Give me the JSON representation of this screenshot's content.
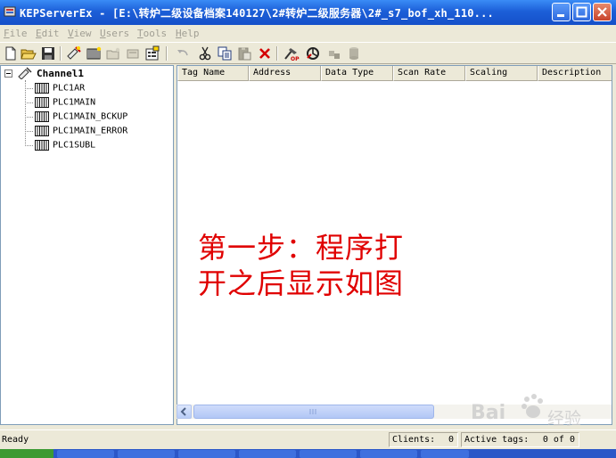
{
  "window": {
    "title": "KEPServerEx - [E:\\转炉二级设备档案140127\\2#转炉二级服务器\\2#_s7_bof_xh_110..."
  },
  "menu": {
    "items": [
      {
        "first": "F",
        "rest": "ile"
      },
      {
        "first": "E",
        "rest": "dit"
      },
      {
        "first": "V",
        "rest": "iew"
      },
      {
        "first": "U",
        "rest": "sers"
      },
      {
        "first": "T",
        "rest": "ools"
      },
      {
        "first": "H",
        "rest": "elp"
      }
    ]
  },
  "toolbar": {
    "icons": [
      "new-file-icon",
      "open-folder-icon",
      "save-icon",
      "new-channel-icon",
      "new-device-icon",
      "new-group-icon",
      "new-tag-icon",
      "properties-icon",
      "undo-icon",
      "cut-icon",
      "copy-icon",
      "paste-icon",
      "delete-icon",
      "quick-client-icon",
      "runtime-connect-icon",
      "runtime-icon",
      "database-icon"
    ]
  },
  "tree": {
    "channel": "Channel1",
    "devices": [
      "PLC1AR",
      "PLC1MAIN",
      "PLC1MAIN_BCKUP",
      "PLC1MAIN_ERROR",
      "PLC1SUBL"
    ]
  },
  "table": {
    "columns": [
      "Tag Name",
      "Address",
      "Data Type",
      "Scan Rate",
      "Scaling",
      "Description"
    ]
  },
  "annotation": {
    "line1": "第一步：程序打",
    "line2": "开之后显示如图"
  },
  "status": {
    "ready": "Ready",
    "clients_label": "Clients:",
    "clients_value": "0",
    "active_tags_label": "Active tags:",
    "active_tags_value": "0 of 0"
  },
  "watermark": {
    "brand": "Bai",
    "suffix": "经验"
  },
  "colors": {
    "titlebar": "#1c5fd8",
    "annotation": "#e00000"
  }
}
